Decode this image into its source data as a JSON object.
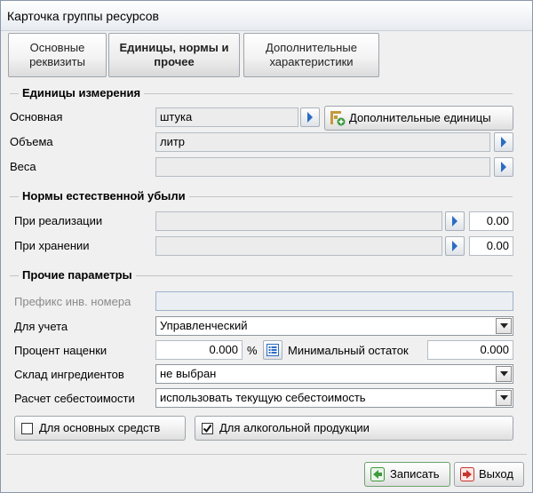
{
  "window": {
    "title": "Карточка группы ресурсов"
  },
  "tabs": [
    {
      "line1": "Основные",
      "line2": "реквизиты"
    },
    {
      "line1": "Единицы, нормы и",
      "line2": "прочее"
    },
    {
      "line1": "Дополнительные",
      "line2": "характеристики"
    }
  ],
  "units": {
    "section_title": "Единицы измерения",
    "basic_label": "Основная",
    "basic_value": "штука",
    "extra_units_button": "Дополнительные единицы",
    "volume_label": "Объема",
    "volume_value": "литр",
    "weight_label": "Веса",
    "weight_value": ""
  },
  "norms": {
    "section_title": "Нормы естественной убыли",
    "sale_label": "При реализации",
    "sale_value": "0.00",
    "storage_label": "При хранении",
    "storage_value": "0.00"
  },
  "other": {
    "section_title": "Прочие параметры",
    "inv_prefix_label": "Префикс инв. номера",
    "inv_prefix_value": "",
    "accounting_label": "Для учета",
    "accounting_value": "Управленческий",
    "markup_label": "Процент наценки",
    "markup_value": "0.000",
    "percent_sign": "%",
    "min_rest_label": "Минимальный остаток",
    "min_rest_value": "0.000",
    "warehouse_label": "Склад ингредиентов",
    "warehouse_value": "не выбран",
    "costing_label": "Расчет себестоимости",
    "costing_value": "использовать текущую себестоимость",
    "fixed_assets_label": "Для основных средств",
    "fixed_assets_checked": false,
    "alcohol_label": "Для алкогольной продукции",
    "alcohol_checked": true
  },
  "footer": {
    "save_label": "Записать",
    "exit_label": "Выход"
  },
  "colors": {
    "arrow_blue": "#2b6cc4",
    "save_icon_green": "#3f9a3f",
    "exit_icon_red": "#c8352e"
  }
}
